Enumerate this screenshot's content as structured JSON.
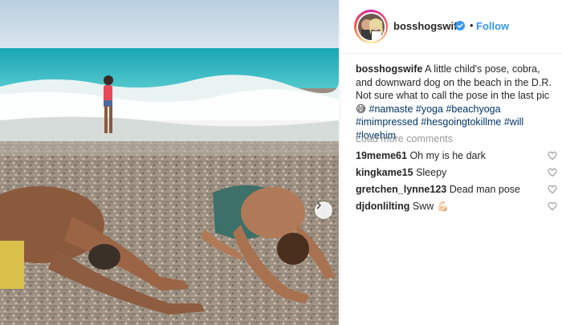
{
  "post": {
    "username": "bosshogswife",
    "follow_label": "Follow",
    "dot": "•",
    "caption_text": "A little child's pose, cobra, and downward dog on the beach in the D.R. Not sure what to call the pose in the last pic 😅",
    "hashtags": [
      "#namaste",
      "#yoga",
      "#beachyoga",
      "#imimpressed",
      "#hesgoingtokillme",
      "#will",
      "#lovehim"
    ],
    "load_more": "Load more comments"
  },
  "comments": [
    {
      "user": "19meme61",
      "text": "Oh my is he dark"
    },
    {
      "user": "kingkame15",
      "text": "Sleepy"
    },
    {
      "user": "gretchen_lynne123",
      "text": "Dead man pose"
    },
    {
      "user": "djdonlilting",
      "text": "Sww 💪🏻"
    }
  ],
  "icons": {
    "verified": "verified-badge-icon",
    "heart": "heart-outline-icon",
    "next": "chevron-right-icon"
  },
  "colors": {
    "link_blue": "#3897f0",
    "hashtag": "#003569",
    "muted": "#999999",
    "text": "#262626"
  }
}
